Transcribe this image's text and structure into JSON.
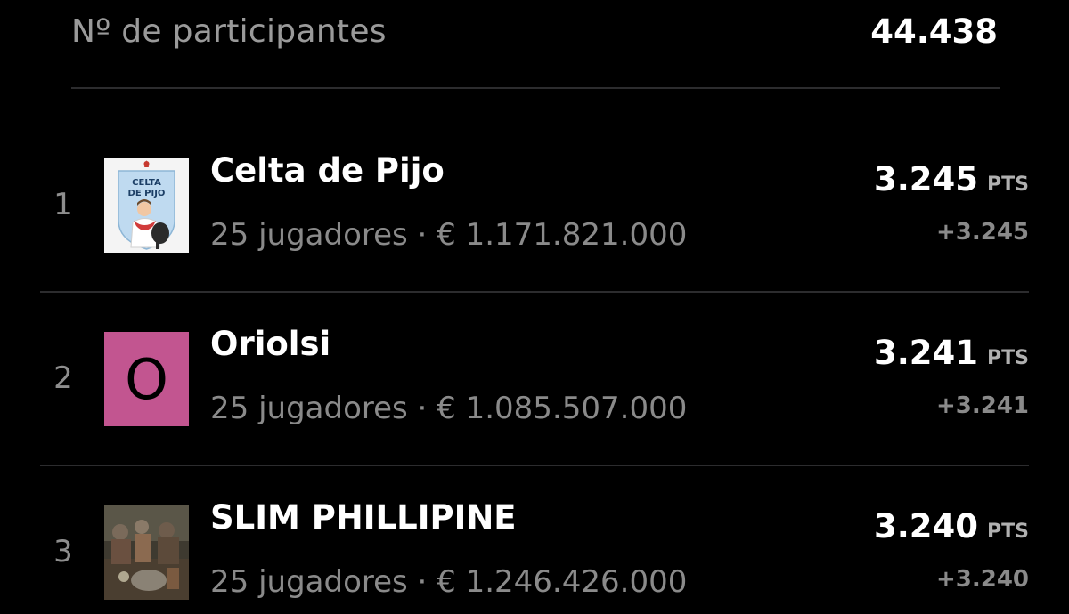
{
  "header": {
    "label": "Nº de participantes",
    "value": "44.438"
  },
  "ranking": [
    {
      "rank": "1",
      "avatar_type": "badge",
      "avatar_text": "CELTA DE PIJO",
      "name": "Celta de Pijo",
      "meta": "25 jugadores · € 1.171.821.000",
      "points": "3.245",
      "points_unit": "PTS",
      "delta": "+3.245"
    },
    {
      "rank": "2",
      "avatar_type": "letter",
      "avatar_text": "O",
      "avatar_color": "#c25590",
      "name": "Oriolsi",
      "meta": "25 jugadores · € 1.085.507.000",
      "points": "3.241",
      "points_unit": "PTS",
      "delta": "+3.241"
    },
    {
      "rank": "3",
      "avatar_type": "photo",
      "name": "SLIM PHILLIPINE",
      "meta": "25 jugadores · € 1.246.426.000",
      "points": "3.240",
      "points_unit": "PTS",
      "delta": "+3.240"
    }
  ]
}
